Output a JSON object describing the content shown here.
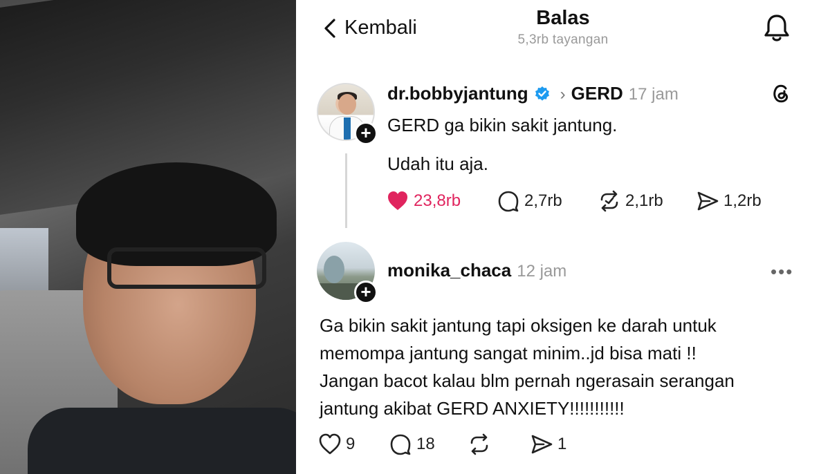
{
  "header": {
    "back_label": "Kembali",
    "title": "Balas",
    "views": "5,3rb tayangan"
  },
  "post": {
    "username": "dr.bobbyjantung",
    "topic": "GERD",
    "time": "17 jam",
    "line1": "GERD ga bikin sakit jantung.",
    "line2": "Udah itu aja.",
    "likes": "23,8rb",
    "replies": "2,7rb",
    "reposts": "2,1rb",
    "shares": "1,2rb",
    "like_color": "#e0245e"
  },
  "reply": {
    "username": "monika_chaca",
    "time": "12 jam",
    "lines": [
      "Ga bikin sakit jantung tapi oksigen ke darah untuk",
      "memompa jantung sangat minim..jd bisa mati !!",
      "Jangan bacot kalau blm pernah ngerasain serangan",
      "jantung akibat GERD ANXIETY!!!!!!!!!!!"
    ],
    "likes": "9",
    "replies": "18",
    "shares": "1"
  },
  "icons": {
    "back": "chevron-left-icon",
    "bell": "bell-icon",
    "verified": "verified-badge-icon",
    "threads": "threads-logo-icon",
    "more": "more-horizontal-icon",
    "heart": "heart-icon",
    "comment": "comment-icon",
    "repost": "repost-icon",
    "share": "share-icon"
  },
  "colors": {
    "verified": "#1d9bf0",
    "muted": "#999999"
  }
}
